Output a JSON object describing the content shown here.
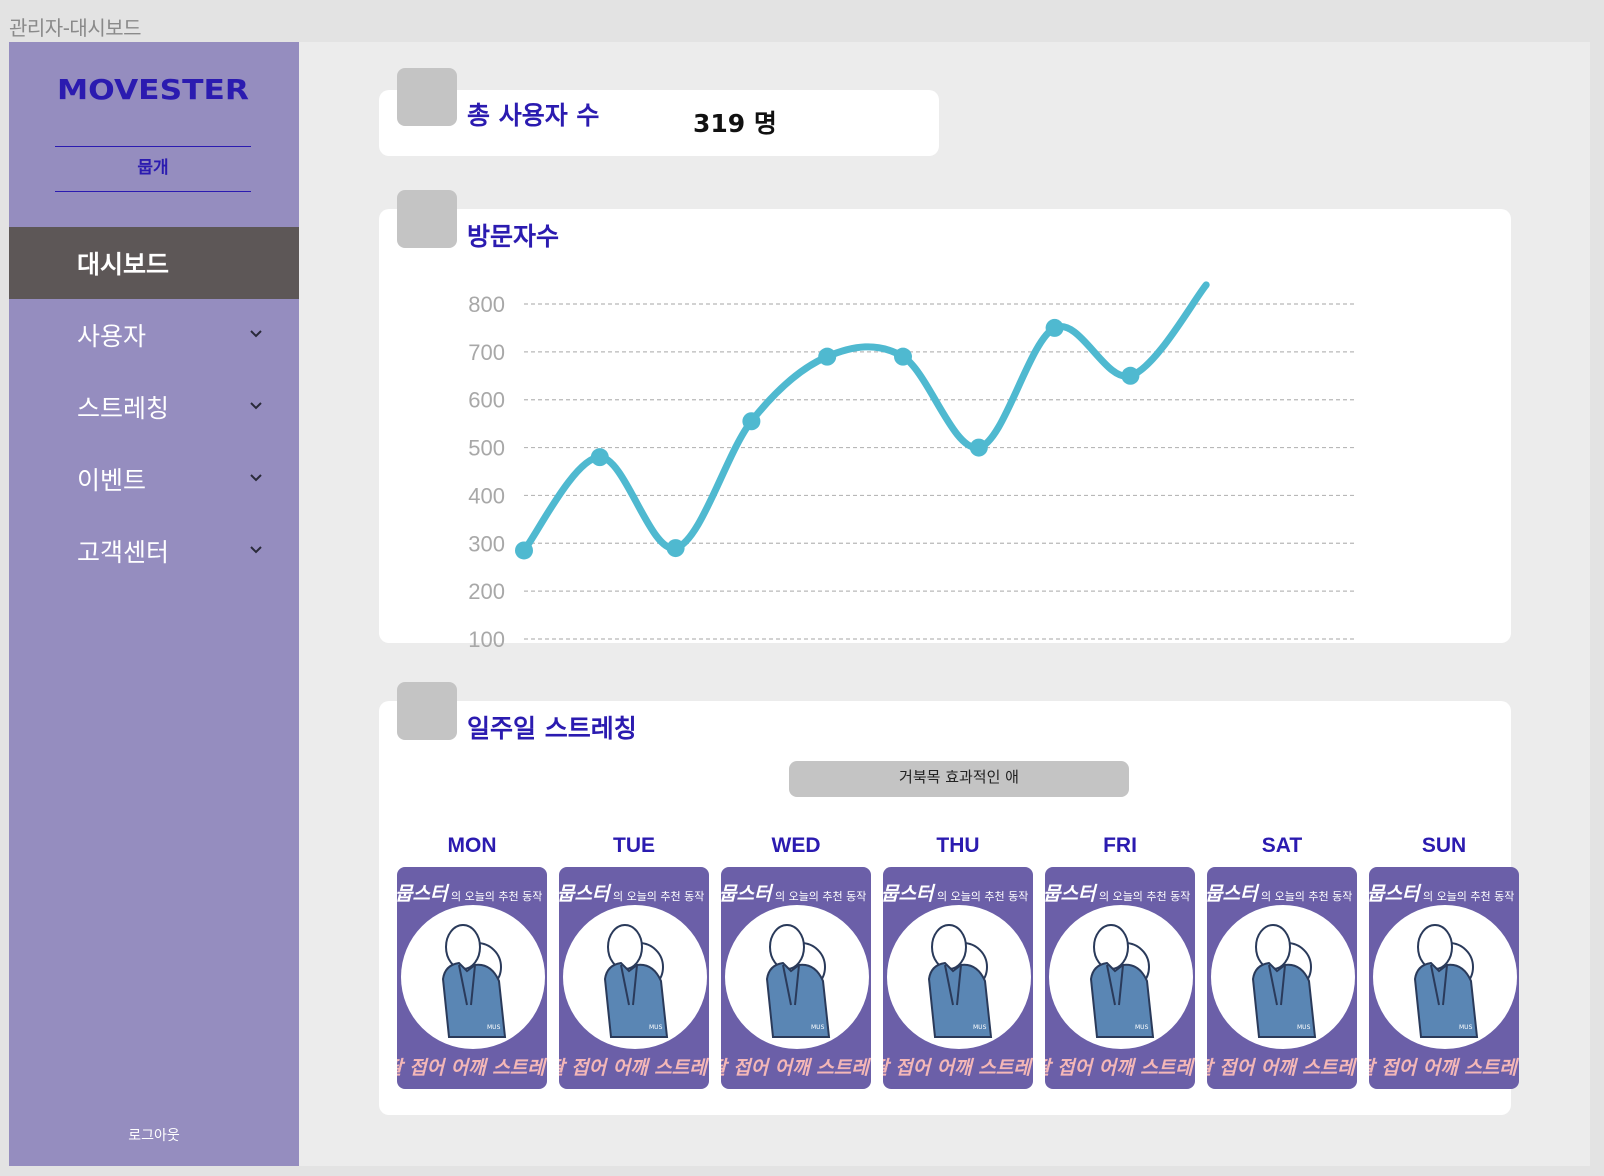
{
  "window": {
    "title": "관리자-대시보드"
  },
  "brand": {
    "logo_text": "MOVESTER",
    "accent": "#2b1bb0",
    "sidebar_bg": "#958dbf",
    "active_bg": "#5d5757"
  },
  "sidebar": {
    "user_name": "뭅개",
    "items": [
      {
        "label": "대시보드",
        "active": true
      },
      {
        "label": "사용자",
        "icon": "chevron-down-icon"
      },
      {
        "label": "스트레칭",
        "icon": "chevron-down-icon"
      },
      {
        "label": "이벤트",
        "icon": "chevron-down-icon"
      },
      {
        "label": "고객센터",
        "icon": "chevron-down-icon"
      }
    ],
    "logout": "로그아웃"
  },
  "total_users": {
    "title": "총 사용자 수",
    "value": "319 명"
  },
  "visitors": {
    "title": "방문자수",
    "chart_data": {
      "type": "line",
      "y_ticks": [
        "100",
        "200",
        "300",
        "400",
        "500",
        "600",
        "700",
        "800"
      ],
      "ylim": [
        100,
        800
      ],
      "grid": "dashed horizontal",
      "series": [
        {
          "values": [
            285,
            480,
            290,
            555,
            690,
            690,
            500,
            750,
            650,
            840
          ],
          "color": "#4fb9d0"
        }
      ]
    }
  },
  "weekly": {
    "title": "일주일 스트레칭",
    "button_label": "거북목 효과적인 애",
    "days": [
      {
        "label": "MON",
        "brand": "뭅스터",
        "subtitle": "의 오늘의 추천 동작",
        "caption": "팔 접어 어깨 스트레칭"
      },
      {
        "label": "TUE",
        "brand": "뭅스터",
        "subtitle": "의 오늘의 추천 동작",
        "caption": "팔 접어 어깨 스트레칭"
      },
      {
        "label": "WED",
        "brand": "뭅스터",
        "subtitle": "의 오늘의 추천 동작",
        "caption": "팔 접어 어깨 스트레칭"
      },
      {
        "label": "THU",
        "brand": "뭅스터",
        "subtitle": "의 오늘의 추천 동작",
        "caption": "팔 접어 어깨 스트레칭"
      },
      {
        "label": "FRI",
        "brand": "뭅스터",
        "subtitle": "의 오늘의 추천 동작",
        "caption": "팔 접어 어깨 스트레칭"
      },
      {
        "label": "SAT",
        "brand": "뭅스터",
        "subtitle": "의 오늘의 추천 동작",
        "caption": "팔 접어 어깨 스트레칭"
      },
      {
        "label": "SUN",
        "brand": "뭅스터",
        "subtitle": "의 오늘의 추천 동작",
        "caption": "팔 접어 어깨 스트레칭"
      }
    ]
  }
}
